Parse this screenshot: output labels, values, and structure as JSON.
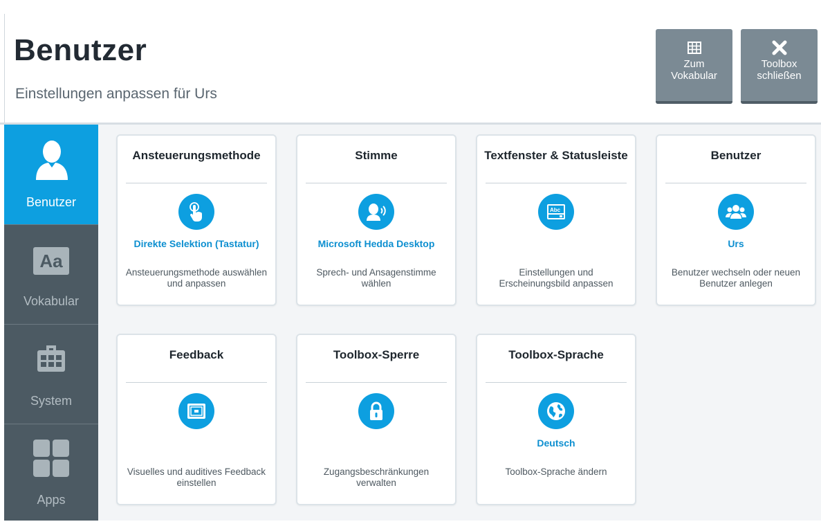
{
  "header": {
    "title": "Benutzer",
    "subtitle": "Einstellungen anpassen für Urs",
    "vocab_button": {
      "line1": "Zum",
      "line2": "Vokabular",
      "icon": "grid-icon"
    },
    "close_button": {
      "line1": "Toolbox",
      "line2": "schließen",
      "icon": "close-icon"
    }
  },
  "sidebar": {
    "items": [
      {
        "label": "Benutzer",
        "icon": "user-icon",
        "active": true
      },
      {
        "label": "Vokabular",
        "icon": "text-aa-icon",
        "badge": "Aa",
        "active": false
      },
      {
        "label": "System",
        "icon": "toolbox-icon",
        "active": false
      },
      {
        "label": "Apps",
        "icon": "apps-grid-icon",
        "active": false
      }
    ]
  },
  "cards": [
    {
      "title": "Ansteuerungsmethode",
      "icon": "touch-icon",
      "value": "Direkte Selektion (Tastatur)",
      "description": "Ansteuerungsmethode auswählen und anpassen"
    },
    {
      "title": "Stimme",
      "icon": "speaking-head-icon",
      "value": "Microsoft Hedda Desktop",
      "description": "Sprech- und Ansagenstimme wählen"
    },
    {
      "title": "Textfenster & Statusleiste",
      "icon": "text-window-icon",
      "icon_text": "Abc",
      "value": "",
      "description": "Einstellungen und Erscheinungsbild anpassen"
    },
    {
      "title": "Benutzer",
      "icon": "users-icon",
      "value": "Urs",
      "description": "Benutzer wechseln oder neuen Benutzer anlegen"
    },
    {
      "title": "Feedback",
      "icon": "feedback-screen-icon",
      "value": "",
      "description": "Visuelles und auditives Feedback einstellen"
    },
    {
      "title": "Toolbox-Sperre",
      "icon": "lock-icon",
      "value": "",
      "description": "Zugangsbeschränkungen verwalten"
    },
    {
      "title": "Toolbox-Sprache",
      "icon": "globe-icon",
      "value": "Deutsch",
      "description": "Toolbox-Sprache ändern"
    }
  ],
  "colors": {
    "accent": "#0d9fe0",
    "sidebar": "#4c5a63",
    "button": "#7b8a94"
  }
}
